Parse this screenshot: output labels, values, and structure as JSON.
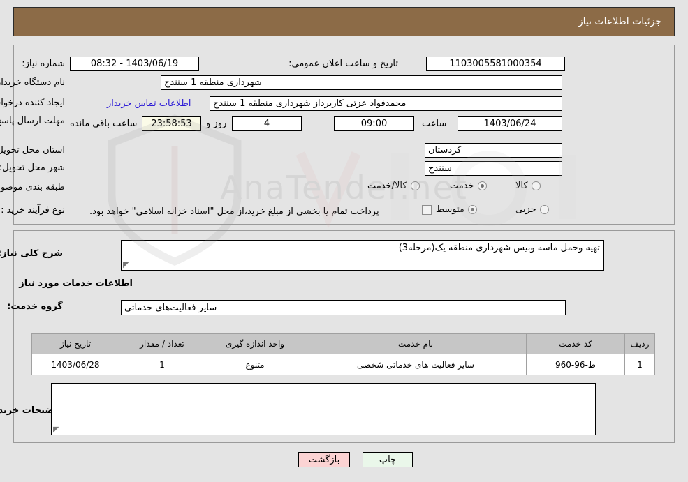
{
  "header": {
    "title": "جزئیات اطلاعات نیاز"
  },
  "form": {
    "need_number_label": "شماره نیاز:",
    "need_number_value": "1103005581000354",
    "announce_label": "تاریخ و ساعت اعلان عمومی:",
    "announce_value": "1403/06/19 - 08:32",
    "buyer_org_label": "نام دستگاه خریدار:",
    "buyer_org_value": "شهرداری منطقه 1 سنندج",
    "creator_label": "ایجاد کننده درخواست:",
    "creator_value": "محمدفواد عزتی کاربرداز شهرداری منطقه 1 سنندج",
    "contact_link": "اطلاعات تماس خریدار",
    "deadline_label": "مهلت ارسال پاسخ: تا تاریخ:",
    "deadline_date": "1403/06/24",
    "hour_label": "ساعت",
    "deadline_time": "09:00",
    "days_value": "4",
    "days_label": "روز و",
    "countdown_value": "23:58:53",
    "remaining_label": "ساعت باقی مانده",
    "province_label": "استان محل تحویل:",
    "province_value": "کردستان",
    "city_label": "شهر محل تحویل:",
    "city_value": "سنندج",
    "category_label": "طبقه بندی موضوعی:",
    "category_options": [
      {
        "label": "کالا",
        "selected": false
      },
      {
        "label": "خدمت",
        "selected": true
      },
      {
        "label": "کالا/خدمت",
        "selected": false
      }
    ],
    "process_label": "نوع فرآیند خرید :",
    "process_options": [
      {
        "label": "جزیی",
        "selected": false
      },
      {
        "label": "متوسط",
        "selected": true
      }
    ],
    "treasury_note": "پرداخت تمام یا بخشی از مبلغ خرید،از محل \"اسناد خزانه اسلامی\" خواهد بود."
  },
  "details": {
    "summary_label": "شرح کلی نیاز:",
    "summary_value": "تهیه وحمل ماسه وبیس شهرداری منطقه یک(مرحله3)",
    "services_heading": "اطلاعات خدمات مورد نیاز",
    "service_group_label": "گروه خدمت:",
    "service_group_value": "سایر فعالیت‌های خدماتی",
    "buyer_notes_label": "توضیحات خریدار:",
    "buyer_notes_value": ""
  },
  "table": {
    "columns": [
      "ردیف",
      "کد خدمت",
      "نام خدمت",
      "واحد اندازه گیری",
      "تعداد / مقدار",
      "تاریخ نیاز"
    ],
    "rows": [
      {
        "row": "1",
        "code": "ط-96-960",
        "name": "سایر فعالیت های خدماتی شخصی",
        "unit": "متنوع",
        "qty": "1",
        "date": "1403/06/28"
      }
    ]
  },
  "buttons": {
    "print": "چاپ",
    "back": "بازگشت"
  },
  "watermark": {
    "text": "AnaTender.net"
  },
  "colors": {
    "header_bg": "#8c6b47",
    "link": "#2a19d6",
    "timer_bg": "#fbfbe8",
    "print_bg": "#eaf7ea",
    "back_bg": "#fbd3d3"
  }
}
